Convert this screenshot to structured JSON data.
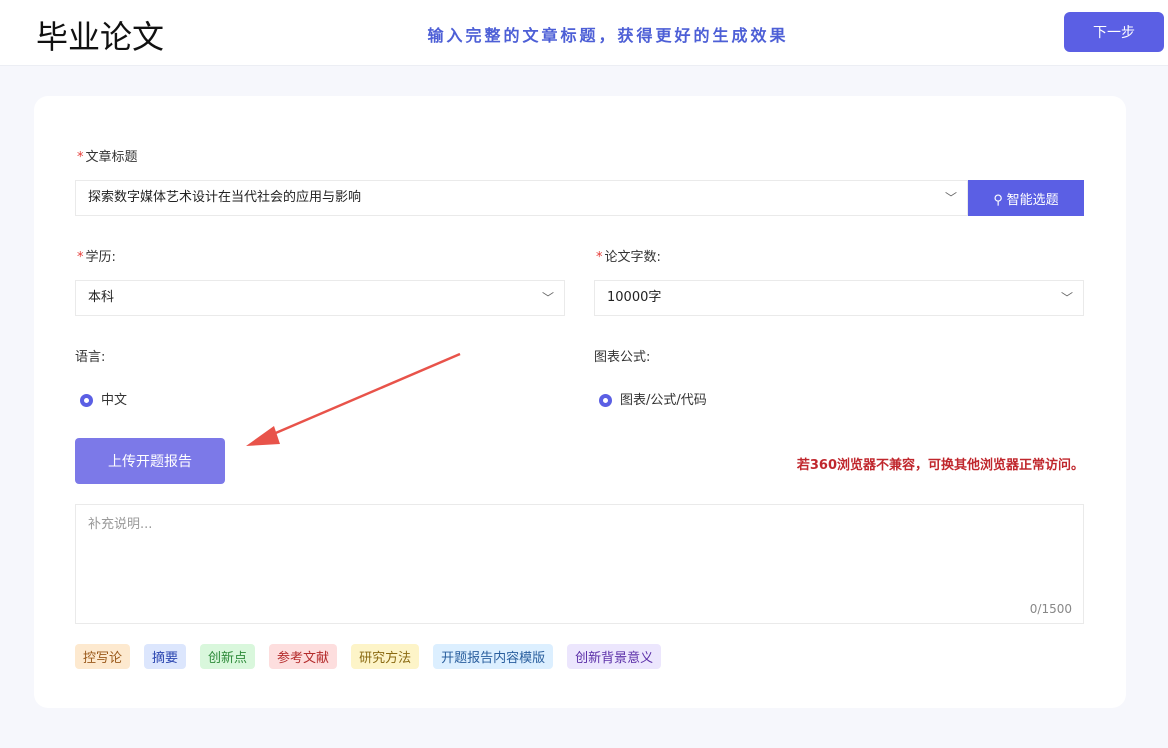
{
  "header": {
    "title": "毕业论文",
    "hint": "输入完整的文章标题，获得更好的生成效果",
    "next_label": "下一步"
  },
  "form": {
    "title_label": "文章标题",
    "title_value": "探索数字媒体艺术设计在当代社会的应用与影响",
    "smart_label": "智能选题",
    "degree_label": "学历:",
    "degree_value": "本科",
    "words_label": "论文字数:",
    "words_value": "10000字",
    "lang_label": "语言:",
    "lang_option": "中文",
    "chart_label": "图表公式:",
    "chart_option": "图表/公式/代码",
    "upload_label": "上传开题报告",
    "warning": "若360浏览器不兼容，可换其他浏览器正常访问。",
    "notes_placeholder": "补充说明...",
    "notes_count": "0/1500"
  },
  "tags": [
    {
      "label": "控写论",
      "bg": "#fde9cf",
      "fg": "#9a5a1c"
    },
    {
      "label": "摘要",
      "bg": "#dce6fd",
      "fg": "#2a45b0"
    },
    {
      "label": "创新点",
      "bg": "#d9f7dc",
      "fg": "#2e8b3a"
    },
    {
      "label": "参考文献",
      "bg": "#fddede",
      "fg": "#b42b2b"
    },
    {
      "label": "研究方法",
      "bg": "#fdf4c8",
      "fg": "#8a6a12"
    },
    {
      "label": "开题报告内容模版",
      "bg": "#dcefff",
      "fg": "#2a5f9e"
    },
    {
      "label": "创新背景意义",
      "bg": "#ece6fd",
      "fg": "#5b2fa8"
    }
  ]
}
